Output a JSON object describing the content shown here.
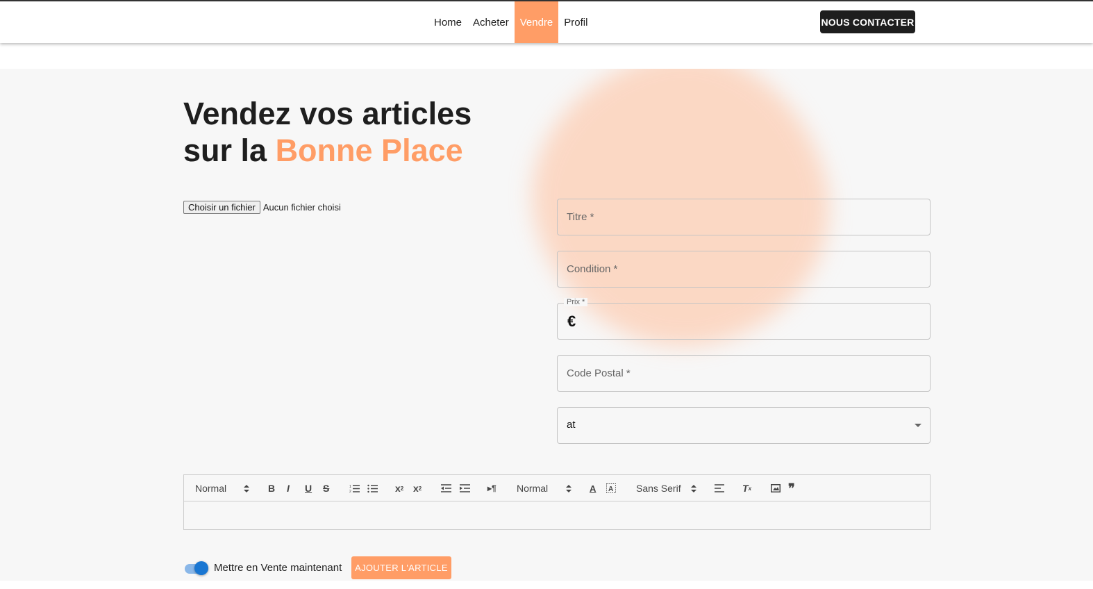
{
  "nav": {
    "links": [
      {
        "label": "Home"
      },
      {
        "label": "Acheter"
      },
      {
        "label": "Vendre",
        "active": true
      },
      {
        "label": "Profil"
      }
    ],
    "contact_label": "NOUS CONTACTER"
  },
  "hero": {
    "line1": "Vendez vos articles",
    "line2_prefix": "sur la ",
    "line2_accent": "Bonne Place"
  },
  "upload": {
    "button_label": "Choisir un fichier",
    "status": "Aucun fichier choisi"
  },
  "form": {
    "titre_label": "Titre *",
    "condition_label": "Condition *",
    "prix_label": "Prix *",
    "prix_currency": "€",
    "code_postal_label": "Code Postal *",
    "select_value": "at"
  },
  "editor": {
    "header_select": "Normal",
    "size_select": "Normal",
    "font_select": "Sans Serif",
    "buttons": [
      "bold",
      "italic",
      "underline",
      "strike",
      "ordered-list",
      "bullet-list",
      "subscript",
      "superscript",
      "outdent",
      "indent",
      "direction",
      "color",
      "background",
      "align",
      "clean",
      "image",
      "blockquote"
    ]
  },
  "footer_actions": {
    "toggle_label": "Mettre en Vente maintenant",
    "toggle_on": true,
    "submit_label": "AJOUTER L'ARTICLE"
  },
  "colors": {
    "accent": "#ff9d66",
    "dark": "#1e1e1e",
    "toggle_blue": "#1976d2"
  }
}
